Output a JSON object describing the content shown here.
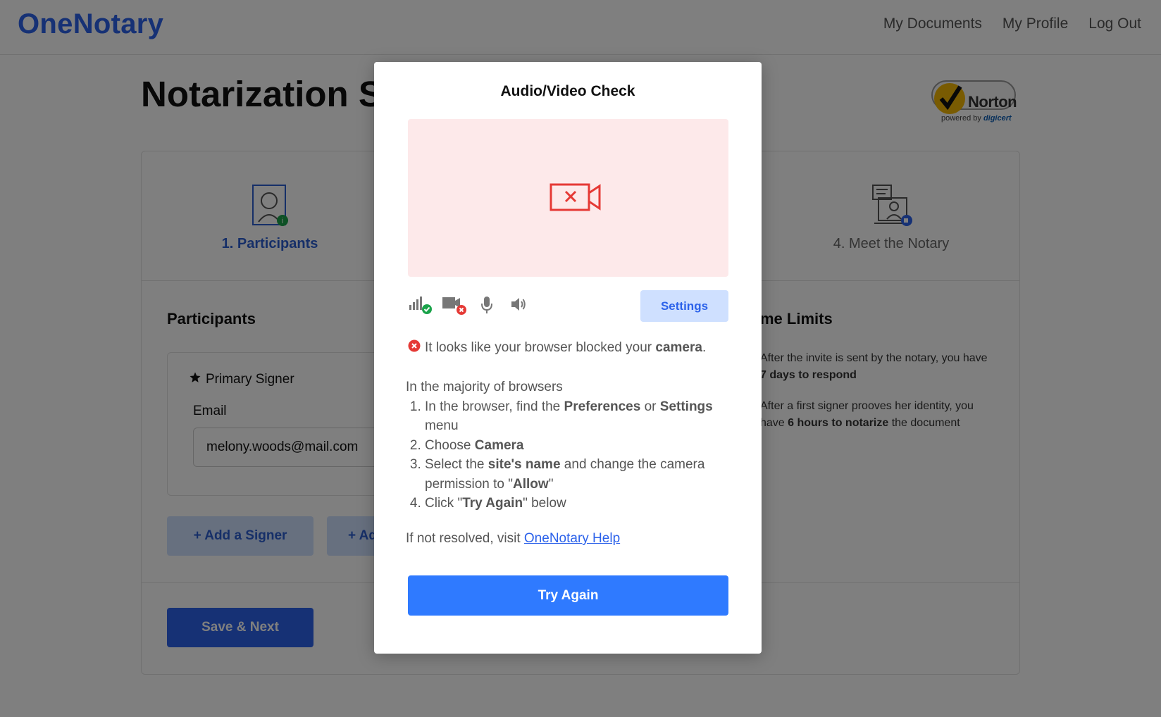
{
  "header": {
    "logo": "OneNotary",
    "nav": [
      "My Documents",
      "My Profile",
      "Log Out"
    ]
  },
  "page": {
    "title": "Notarization S",
    "norton": {
      "name": "Norton",
      "powered_prefix": "powered by ",
      "powered_brand": "digicert"
    }
  },
  "steps": [
    {
      "label": "1. Participants",
      "icon": "participant-icon",
      "active": true
    },
    {
      "label": "4. Meet the Notary",
      "icon": "meet-notary-icon",
      "active": false
    }
  ],
  "participants": {
    "title": "Participants",
    "primary_label": "Primary Signer",
    "email_label": "Email",
    "email_value": "melony.woods@mail.com",
    "add_signer": "+ Add a Signer",
    "add_other": "+ Ad",
    "save_next": "Save & Next"
  },
  "limits": {
    "title": "me Limits",
    "p1_text": "After the invite is sent by the notary, you have ",
    "p1_bold": "7 days to respond",
    "p2_text": "After a first signer prooves her identity, you have ",
    "p2_bold": "6 hours to notarize",
    "p2_end": " the document"
  },
  "modal": {
    "title": "Audio/Video Check",
    "settings": "Settings",
    "error_text": "It looks like your browser blocked your ",
    "error_bold": "camera",
    "error_end": ".",
    "intro": "In the majority of browsers",
    "s1a": "In the browser, find the ",
    "s1b": "Preferences",
    "s1c": " or ",
    "s1d": "Settings",
    "s1e": " menu",
    "s2a": "Choose ",
    "s2b": "Camera",
    "s3a": "Select the ",
    "s3b": "site's name",
    "s3c": " and change the camera permission to \"",
    "s3d": "Allow",
    "s3e": "\"",
    "s4a": "Click \"",
    "s4b": "Try Again",
    "s4c": "\" below",
    "help_text": "If not resolved, visit ",
    "help_link": "OneNotary Help",
    "try_again": "Try Again"
  },
  "colors": {
    "brand": "#2c62ea",
    "error": "#e53935",
    "ok": "#1aa34a"
  }
}
